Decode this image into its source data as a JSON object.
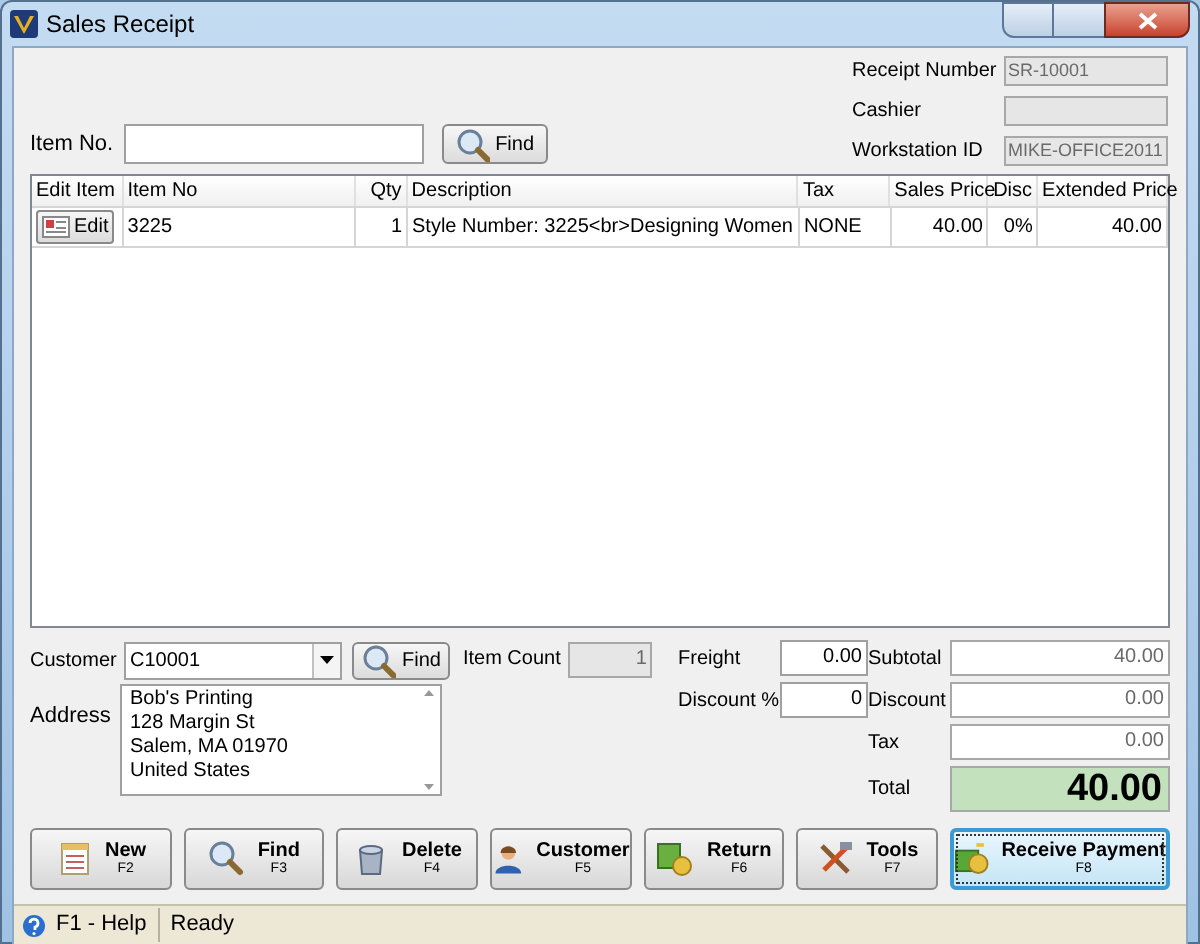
{
  "window": {
    "title": "Sales Receipt"
  },
  "receipt": {
    "fields": [
      {
        "label": "Receipt Number",
        "value": "SR-10001"
      },
      {
        "label": "Cashier"
      },
      {
        "label": "Workstation ID",
        "value": "MIKE-OFFICE2011"
      }
    ]
  },
  "item_search": {
    "label": "Item No.",
    "button": "Find"
  },
  "table": {
    "columns": [
      "Edit Item",
      "Item No",
      "Qty",
      "Description",
      "Tax",
      "Sales Price",
      "Disc",
      "Extended Price"
    ],
    "rows": [
      {
        "edit": "Edit",
        "item_no": "3225",
        "qty": "1",
        "description": "Style Number: 3225<br>Designing Women",
        "tax": "NONE",
        "sales_price": "40.00",
        "disc": "0%",
        "extended_price": "40.00"
      }
    ]
  },
  "customer": {
    "label": "Customer",
    "value": "C10001",
    "button": "Find",
    "address_label": "Address",
    "address": [
      "Bob's Printing",
      "128 Margin St",
      "Salem, MA 01970",
      "United States"
    ]
  },
  "item_count": {
    "label": "Item Count",
    "value": "1"
  },
  "freight": {
    "label": "Freight",
    "value": "0.00"
  },
  "discount_pct": {
    "label": "Discount %",
    "value": "0"
  },
  "totals": [
    {
      "label": "Subtotal",
      "value": "40.00"
    },
    {
      "label": "Discount",
      "value": "0.00"
    },
    {
      "label": "Tax",
      "value": "0.00"
    }
  ],
  "total": {
    "label": "Total",
    "value": "40.00"
  },
  "buttons": [
    {
      "label": "New",
      "key": "F2",
      "focused": false
    },
    {
      "label": "Find",
      "key": "F3",
      "focused": false
    },
    {
      "label": "Delete",
      "key": "F4",
      "focused": false
    },
    {
      "label": "Customer",
      "key": "F5",
      "focused": false
    },
    {
      "label": "Return",
      "key": "F6",
      "focused": false
    },
    {
      "label": "Tools",
      "key": "F7",
      "focused": false
    },
    {
      "label": "Receive Payment",
      "key": "F8",
      "focused": true
    }
  ],
  "status_bar": {
    "help": "F1 - Help",
    "status": "Ready"
  }
}
